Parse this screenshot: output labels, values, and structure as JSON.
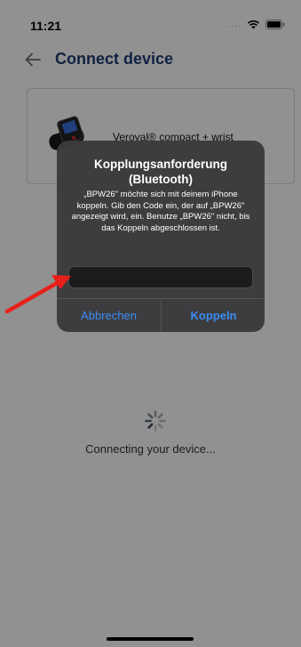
{
  "status_bar": {
    "time": "11:21",
    "signal_dots": "...."
  },
  "header": {
    "title": "Connect device"
  },
  "device": {
    "name": "Veroval® compact + wrist"
  },
  "connecting": {
    "text": "Connecting your device..."
  },
  "alert": {
    "title": "Kopplungsanforderung (Bluetooth)",
    "message": "„BPW26\" möchte sich mit deinem iPhone koppeln. Gib den Code ein, der auf „BPW26\" angezeigt wird, ein. Benutze „BPW26\" nicht, bis das Koppeln abgeschlossen ist.",
    "code_value": "",
    "cancel_label": "Abbrechen",
    "pair_label": "Koppeln"
  },
  "colors": {
    "accent": "#3c8cf5",
    "title_navy": "#1f3d73",
    "annotation_red": "#e8201a"
  }
}
